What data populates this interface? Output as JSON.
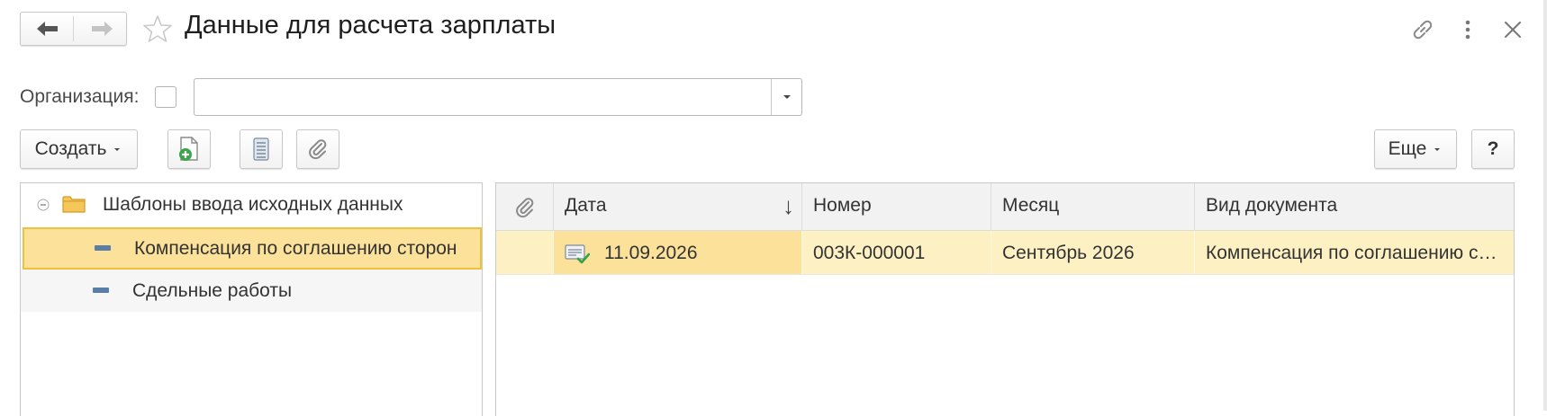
{
  "window": {
    "title": "Данные для расчета зарплаты"
  },
  "filter": {
    "organization_label": "Организация:",
    "organization_value": ""
  },
  "toolbar": {
    "create_label": "Создать",
    "more_label": "Еще",
    "help_label": "?"
  },
  "tree": {
    "root_label": "Шаблоны ввода исходных данных",
    "items": [
      {
        "label": "Компенсация по соглашению сторон",
        "selected": true
      },
      {
        "label": "Сдельные работы",
        "selected": false
      }
    ]
  },
  "grid": {
    "columns": [
      "Дата",
      "Номер",
      "Месяц",
      "Вид документа"
    ],
    "sort_indicator": "↓",
    "rows": [
      {
        "date": "11.09.2026",
        "number": "003К-000001",
        "month": "Сентябрь 2026",
        "doc_type": "Компенсация по соглашению с…"
      }
    ]
  },
  "icons": {
    "back": "arrow-left-icon",
    "forward": "arrow-right-icon",
    "favorite": "star-icon",
    "link": "link-icon",
    "menu": "more-vertical-icon",
    "close": "close-icon",
    "attach_column": "paperclip-icon",
    "posted_doc": "document-posted-icon",
    "folder": "folder-icon",
    "collapse": "collapse-icon"
  },
  "colors": {
    "selection": "#fbe199",
    "selection_border": "#f0c23c",
    "row_highlight": "#fdf0c2",
    "header_bg": "#f2f2f2"
  }
}
